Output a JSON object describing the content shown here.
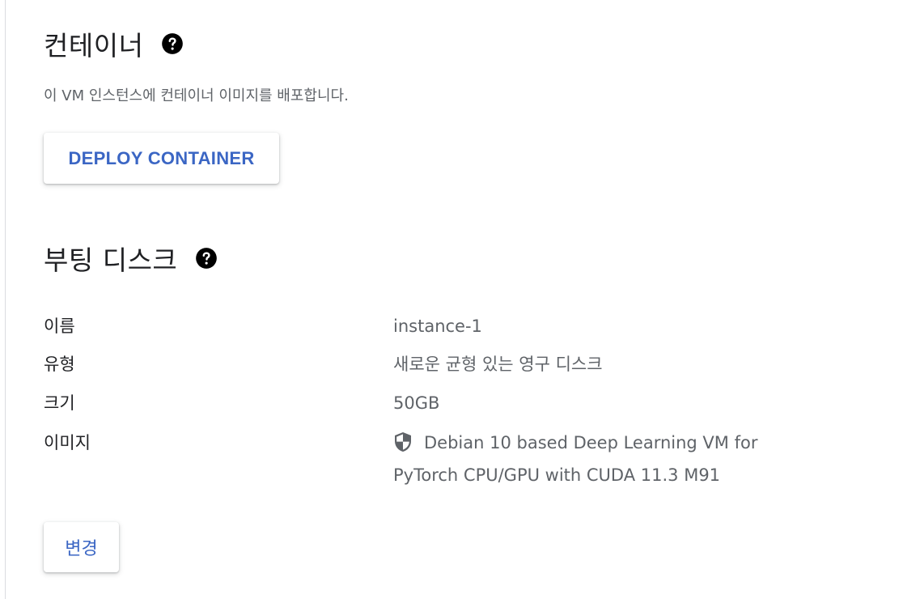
{
  "container_section": {
    "title": "컨테이너",
    "help_icon": "help-circle-icon",
    "description": "이 VM 인스턴스에 컨테이너 이미지를 배포합니다.",
    "deploy_button_label": "DEPLOY CONTAINER"
  },
  "boot_disk_section": {
    "title": "부팅 디스크",
    "help_icon": "help-circle-icon",
    "fields": [
      {
        "label": "이름",
        "value": "instance-1"
      },
      {
        "label": "유형",
        "value": "새로운 균형 있는 영구 디스크"
      },
      {
        "label": "크기",
        "value": "50GB"
      },
      {
        "label": "이미지",
        "value": "Debian 10 based Deep Learning VM for PyTorch CPU/GPU with CUDA 11.3 M91",
        "icon": "shield-icon"
      }
    ],
    "change_button_label": "변경"
  },
  "colors": {
    "accent": "#3b66c4",
    "text_primary": "#202124",
    "text_secondary": "#5f6368",
    "divider": "#dadce0"
  }
}
